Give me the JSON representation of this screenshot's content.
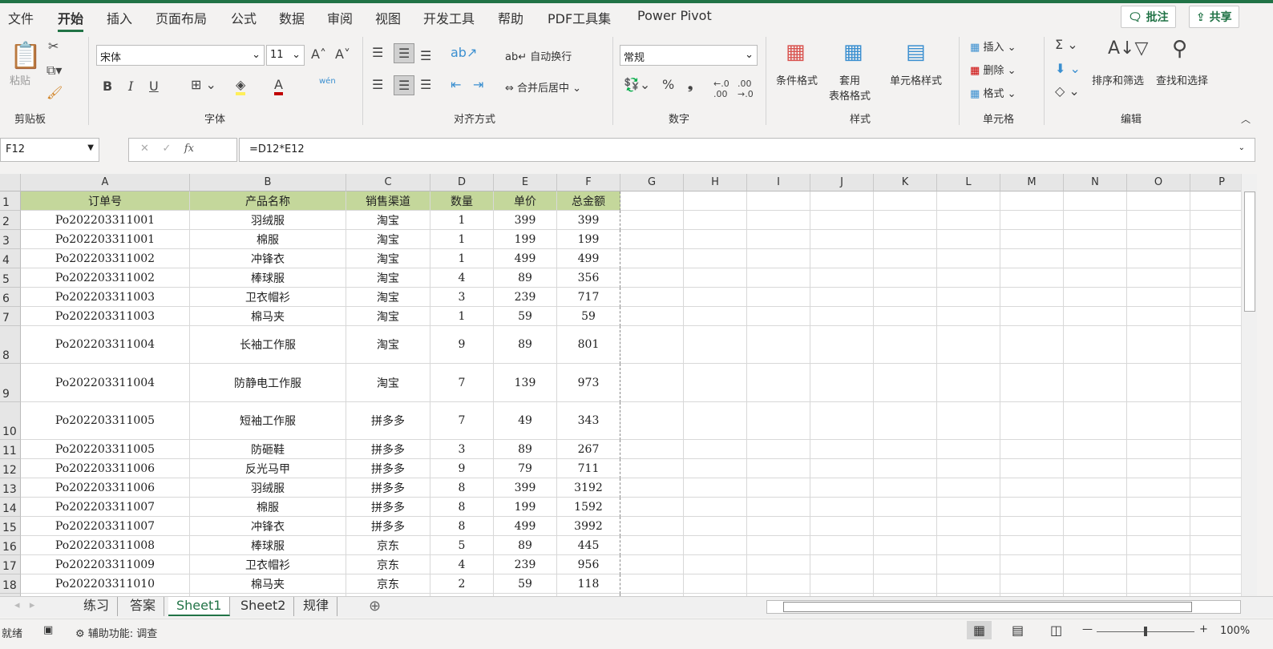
{
  "menu_tabs": [
    "文件",
    "开始",
    "插入",
    "页面布局",
    "公式",
    "数据",
    "审阅",
    "视图",
    "开发工具",
    "帮助",
    "PDF工具集",
    "Power Pivot"
  ],
  "active_tab": "开始",
  "comment_btn": "批注",
  "share_btn": "共享",
  "ribbon": {
    "paste": "粘贴",
    "clipboard": "剪贴板",
    "font_name": "宋体",
    "font_size": "11",
    "font_group": "字体",
    "bold": "B",
    "italic": "I",
    "underline": "U",
    "phonetic": "wén",
    "wrap": "自动换行",
    "merge": "合并后居中",
    "align_group": "对齐方式",
    "number_format": "常规",
    "number_group": "数字",
    "cond_format": "条件格式",
    "table_format": "套用\n表格格式",
    "cell_style": "单元格样式",
    "styles_group": "样式",
    "insert": "插入",
    "delete": "删除",
    "format": "格式",
    "cells_group": "单元格",
    "sort_filter": "排序和筛选",
    "find_select": "查找和选择",
    "edit_group": "编辑"
  },
  "formula_bar": {
    "name_box": "F12",
    "formula": "=D12*E12",
    "fx": "fx"
  },
  "columns": [
    "A",
    "B",
    "C",
    "D",
    "E",
    "F",
    "G",
    "H",
    "I",
    "J",
    "K",
    "L",
    "M",
    "N",
    "O",
    "P"
  ],
  "headers": [
    "订单号",
    "产品名称",
    "销售渠道",
    "数量",
    "单价",
    "总金额"
  ],
  "rows": [
    [
      "Po202203311001",
      "羽绒服",
      "淘宝",
      "1",
      "399",
      "399"
    ],
    [
      "Po202203311001",
      "棉服",
      "淘宝",
      "1",
      "199",
      "199"
    ],
    [
      "Po202203311002",
      "冲锋衣",
      "淘宝",
      "1",
      "499",
      "499"
    ],
    [
      "Po202203311002",
      "棒球服",
      "淘宝",
      "4",
      "89",
      "356"
    ],
    [
      "Po202203311003",
      "卫衣帽衫",
      "淘宝",
      "3",
      "239",
      "717"
    ],
    [
      "Po202203311003",
      "棉马夹",
      "淘宝",
      "1",
      "59",
      "59"
    ],
    [
      "Po202203311004",
      "长袖工作服",
      "淘宝",
      "9",
      "89",
      "801"
    ],
    [
      "Po202203311004",
      "防静电工作服",
      "淘宝",
      "7",
      "139",
      "973"
    ],
    [
      "Po202203311005",
      "短袖工作服",
      "拼多多",
      "7",
      "49",
      "343"
    ],
    [
      "Po202203311005",
      "防砸鞋",
      "拼多多",
      "3",
      "89",
      "267"
    ],
    [
      "Po202203311006",
      "反光马甲",
      "拼多多",
      "9",
      "79",
      "711"
    ],
    [
      "Po202203311006",
      "羽绒服",
      "拼多多",
      "8",
      "399",
      "3192"
    ],
    [
      "Po202203311007",
      "棉服",
      "拼多多",
      "8",
      "199",
      "1592"
    ],
    [
      "Po202203311007",
      "冲锋衣",
      "拼多多",
      "8",
      "499",
      "3992"
    ],
    [
      "Po202203311008",
      "棒球服",
      "京东",
      "5",
      "89",
      "445"
    ],
    [
      "Po202203311009",
      "卫衣帽衫",
      "京东",
      "4",
      "239",
      "956"
    ],
    [
      "Po202203311010",
      "棉马夹",
      "京东",
      "2",
      "59",
      "118"
    ]
  ],
  "sheets": [
    "练习",
    "答案",
    "Sheet1",
    "Sheet2",
    "规律"
  ],
  "active_sheet": "Sheet1",
  "status": {
    "ready": "就绪",
    "accessibility": "辅助功能: 调查",
    "zoom": "100%"
  },
  "colors": {
    "accent": "#217346",
    "header_fill": "#c4d79b"
  }
}
